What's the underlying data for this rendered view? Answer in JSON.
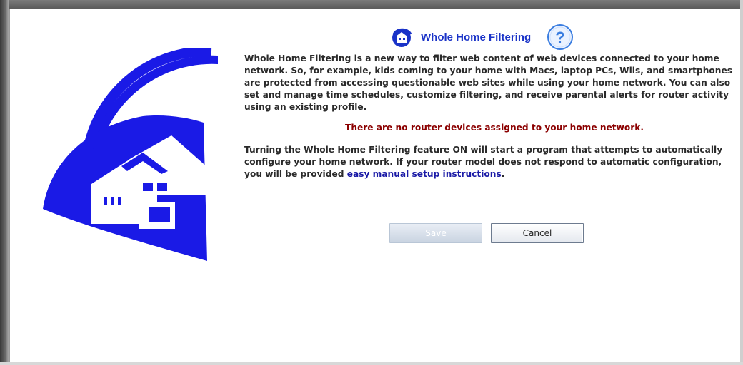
{
  "header": {
    "title": "Whole Home Filtering",
    "help_icon": "question-mark-circle",
    "title_icon": "globe-shield"
  },
  "intro": {
    "text": "Whole Home Filtering is a new way to filter web content of web devices connected to your home network.  So, for example, kids coming to your home with Macs, laptop PCs, Wiis, and smartphones are protected from accessing questionable web sites while using your home network.  You can also set and manage time schedules, customize filtering, and receive parental alerts for router activity using an existing profile."
  },
  "alert": {
    "text": "There are no router devices assigned to your home network.",
    "color": "#8b0000"
  },
  "instructions": {
    "text_before_link": "Turning the Whole Home Filtering feature ON will start a program that attempts to automatically configure your home network.  If your router model does not respond to automatic configuration, you will be provided ",
    "link_text": "easy manual setup instructions",
    "text_after_link": "."
  },
  "buttons": {
    "save_label": "Save",
    "cancel_label": "Cancel"
  },
  "colors": {
    "brand_blue": "#1a1ae6",
    "title_blue": "#1a33c8",
    "link_blue": "#1a1aa6"
  }
}
